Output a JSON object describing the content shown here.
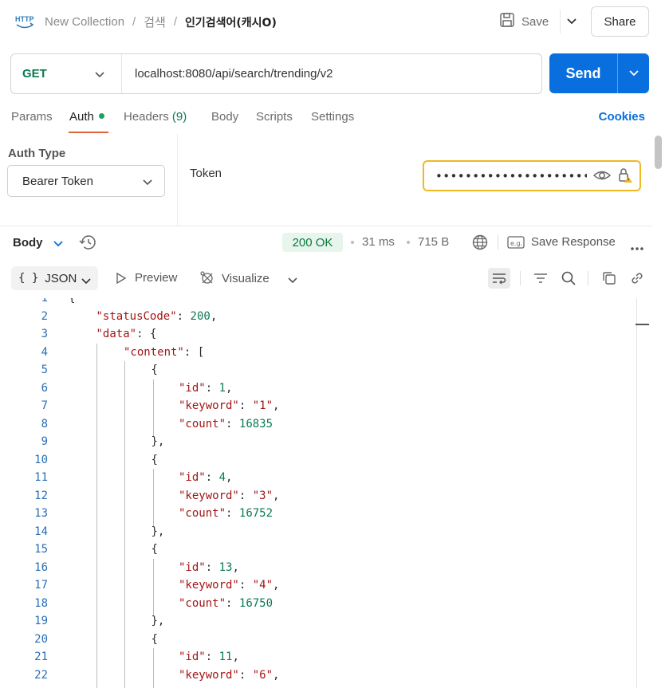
{
  "header": {
    "breadcrumb": [
      "New Collection",
      "검색",
      "인기검색어(캐시O)"
    ],
    "separator": "/",
    "save_label": "Save",
    "share_label": "Share"
  },
  "request": {
    "method": "GET",
    "url": "localhost:8080/api/search/trending/v2",
    "send_label": "Send"
  },
  "tabs": {
    "items": [
      {
        "label": "Params"
      },
      {
        "label": "Auth",
        "active": true,
        "has_dot": true
      },
      {
        "label": "Headers",
        "count": "(9)"
      },
      {
        "label": "Body"
      },
      {
        "label": "Scripts"
      },
      {
        "label": "Settings"
      }
    ],
    "cookies_label": "Cookies"
  },
  "auth": {
    "type_label": "Auth Type",
    "type_value": "Bearer Token",
    "token_label": "Token",
    "token_masked": "••••••••••••••••••••••••"
  },
  "response": {
    "body_label": "Body",
    "status": "200 OK",
    "time": "31 ms",
    "size": "715 B",
    "save_response_label": "Save Response",
    "format_label": "JSON",
    "format_braces": "{ }",
    "preview_label": "Preview",
    "visualize_label": "Visualize"
  },
  "code": {
    "lines": [
      {
        "n": "1",
        "text": "{"
      },
      {
        "n": "2",
        "text": "\"statusCode\": 200,"
      },
      {
        "n": "3",
        "text": "\"data\": {"
      },
      {
        "n": "4",
        "text": "\"content\": ["
      },
      {
        "n": "5",
        "text": "{"
      },
      {
        "n": "6",
        "text": "\"id\": 1,"
      },
      {
        "n": "7",
        "text": "\"keyword\": \"1\","
      },
      {
        "n": "8",
        "text": "\"count\": 16835"
      },
      {
        "n": "9",
        "text": "},"
      },
      {
        "n": "10",
        "text": "{"
      },
      {
        "n": "11",
        "text": "\"id\": 4,"
      },
      {
        "n": "12",
        "text": "\"keyword\": \"3\","
      },
      {
        "n": "13",
        "text": "\"count\": 16752"
      },
      {
        "n": "14",
        "text": "},"
      },
      {
        "n": "15",
        "text": "{"
      },
      {
        "n": "16",
        "text": "\"id\": 13,"
      },
      {
        "n": "17",
        "text": "\"keyword\": \"4\","
      },
      {
        "n": "18",
        "text": "\"count\": 16750"
      },
      {
        "n": "19",
        "text": "},"
      },
      {
        "n": "20",
        "text": "{"
      },
      {
        "n": "21",
        "text": "\"id\": 11,"
      },
      {
        "n": "22",
        "text": "\"keyword\": \"6\","
      }
    ]
  },
  "colors": {
    "accent": "#0a6fde",
    "method_get": "#067a4f",
    "status_ok": "#0b7a3e",
    "tab_underline": "#e0623a",
    "token_highlight": "#f2b824",
    "json_key": "#a31515",
    "json_number": "#0b7a55"
  }
}
